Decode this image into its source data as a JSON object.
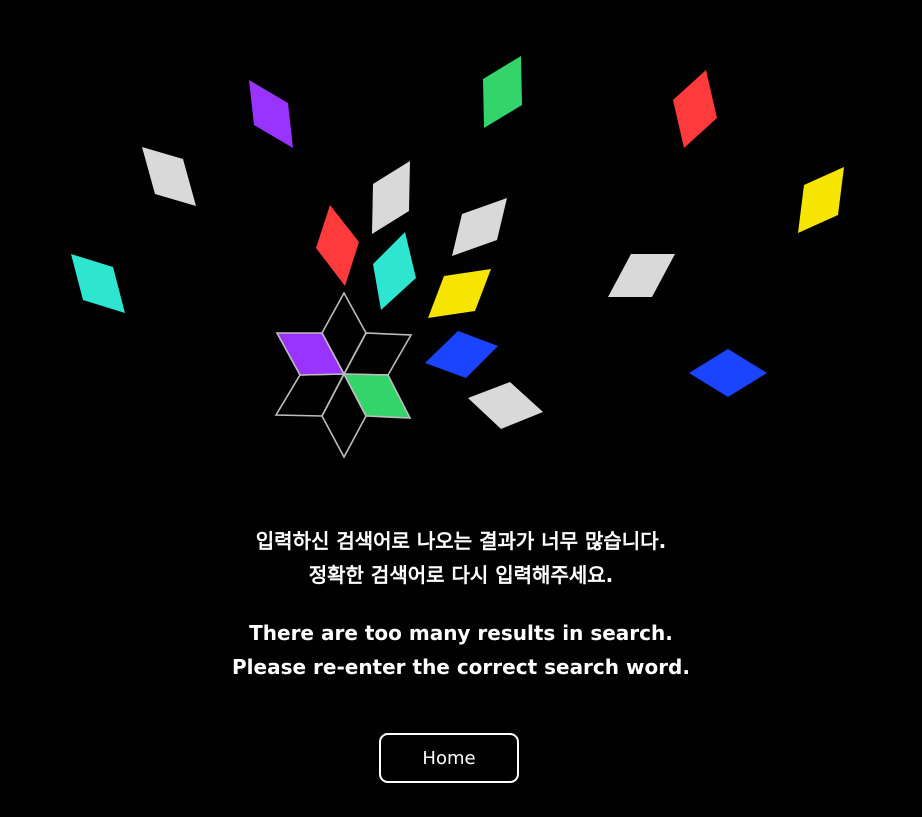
{
  "message": {
    "korean": [
      "입력하신 검색어로 나오는 결과가 너무 많습니다.",
      "정확한 검색어로 다시 입력해주세요."
    ],
    "english": [
      "There are too many results in search.",
      "Please re-enter the correct search word."
    ]
  },
  "home_button": {
    "label": "Home"
  },
  "illustration": {
    "icon": "scattering-diamond-star-icon",
    "colors": {
      "purple": "#9933ff",
      "green": "#33d46a",
      "red": "#ff3a3a",
      "yellow": "#f5e500",
      "teal": "#2ee6d0",
      "blue": "#1a44ff",
      "gray": "#d9d9d9",
      "outline": "#bdbdbd"
    }
  }
}
